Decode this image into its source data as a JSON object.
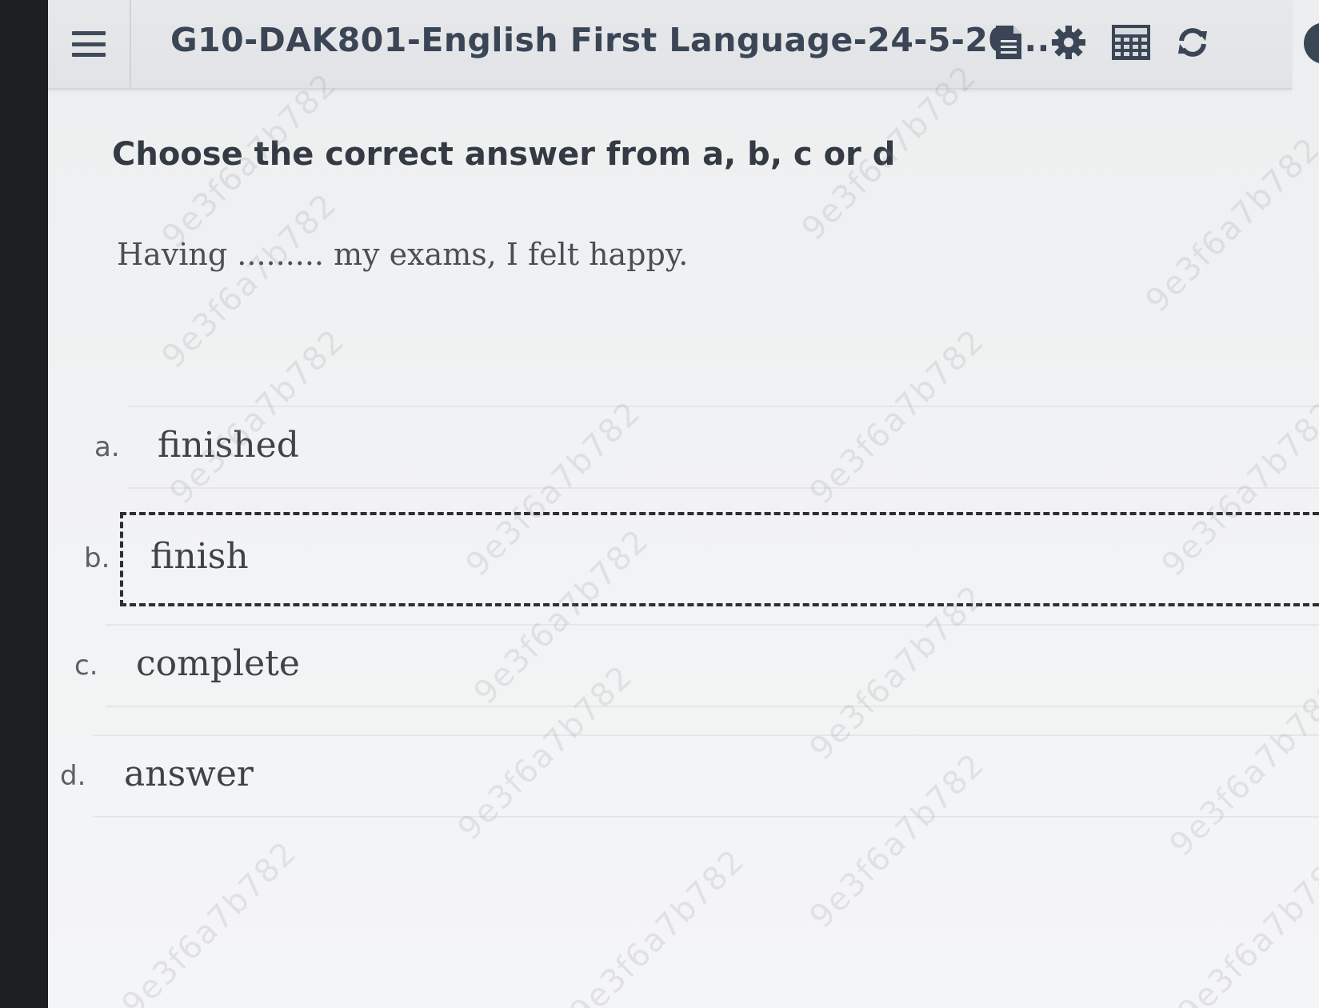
{
  "header": {
    "exam_title": "G10-DAK801-English First Language-24-5-20...",
    "menu_icon": "hamburger-menu-icon",
    "tools": [
      {
        "name": "document-icon"
      },
      {
        "name": "gear-icon"
      },
      {
        "name": "calculator-icon"
      },
      {
        "name": "refresh-icon"
      }
    ]
  },
  "instruction": "Choose the correct answer from a, b, c or d",
  "question": "Having ......... my exams, I felt happy.",
  "options": [
    {
      "letter": "a.",
      "text": "finished",
      "selected": false
    },
    {
      "letter": "b.",
      "text": "finish",
      "selected": true
    },
    {
      "letter": "c.",
      "text": "complete",
      "selected": false
    },
    {
      "letter": "d.",
      "text": "answer",
      "selected": false
    }
  ],
  "watermark": {
    "text": "9e3f6a7b782",
    "color": "#8c8c96"
  },
  "colors": {
    "header_text": "#3a4556",
    "body_text": "#333a44",
    "selection_border": "#2b2f36"
  }
}
